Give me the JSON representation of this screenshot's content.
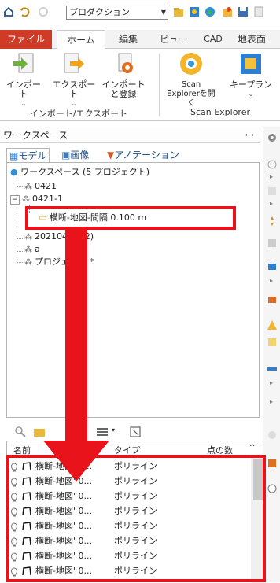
{
  "titlebar": {
    "project_select": "プロダクション"
  },
  "ribbon_tabs": [
    {
      "label": "ファイル"
    },
    {
      "label": "ホーム"
    },
    {
      "label": "編集"
    },
    {
      "label": "ビュー"
    },
    {
      "label": "CAD"
    },
    {
      "label": "地表面"
    }
  ],
  "ribbon": {
    "import_label": "インポート",
    "export_label": "エクスポート",
    "import_register_label": "インポート\nと登録",
    "group1_label": "インポート/エクスポート",
    "scan_explorer_open": "Scan\nExplorerを開く",
    "keyplan_label": "キープラン",
    "group2_label": "Scan Explorer"
  },
  "workspace": {
    "title": "ワークスペース",
    "tabs": [
      "モデル",
      "画像",
      "アノテーション"
    ],
    "root": "ワークスペース (5 プロジェクト)",
    "items": [
      "0421",
      "0421-1",
      "横断-地図-間隔 0.100 m",
      "20210420 (2)",
      "a",
      "プロジェクト *"
    ]
  },
  "list": {
    "col_name": "名前",
    "col_type": "タイプ",
    "col_points": "点の数",
    "rows": [
      {
        "name": "横断-地図' 0...",
        "type": "ポリライン"
      },
      {
        "name": "横断-地図' 0...",
        "type": "ポリライン"
      },
      {
        "name": "横断-地図' 0...",
        "type": "ポリライン"
      },
      {
        "name": "横断-地図' 0...",
        "type": "ポリライン"
      },
      {
        "name": "横断-地図' 0...",
        "type": "ポリライン"
      },
      {
        "name": "横断-地図' 0...",
        "type": "ポリライン"
      },
      {
        "name": "横断-地図' 0...",
        "type": "ポリライン"
      },
      {
        "name": "横断-地図' 0...",
        "type": "ポリライン"
      }
    ]
  },
  "colors": {
    "accent_red": "#e8131b",
    "file_tab": "#cf3b27",
    "link_blue": "#1a4f8c"
  }
}
